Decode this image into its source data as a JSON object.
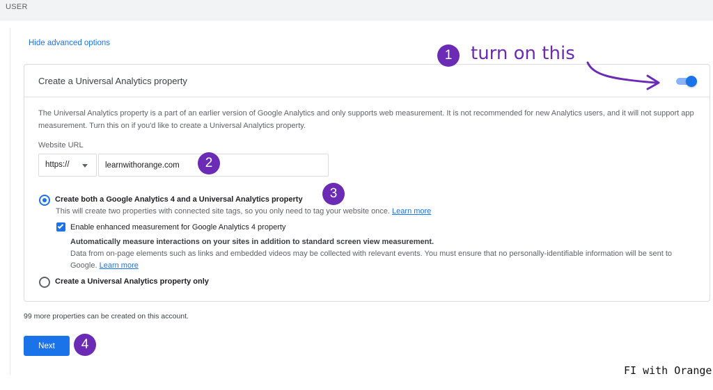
{
  "topbar": {
    "label": "USER"
  },
  "advanced": {
    "hide_label": "Hide advanced options"
  },
  "ua_card": {
    "title": "Create a Universal Analytics property",
    "toggle_on": true,
    "description": "The Universal Analytics property is a part of an earlier version of Google Analytics and only supports web measurement. It is not recommended for new Analytics users, and it will not support app measurement. Turn this on if you'd like to create a Universal Analytics property.",
    "website_url_label": "Website URL",
    "protocol": "https://",
    "url_value": "learnwithorange.com",
    "option_both": {
      "title": "Create both a Google Analytics 4 and a Universal Analytics property",
      "desc": "This will create two properties with connected site tags, so you only need to tag your website once.",
      "learn_more": "Learn more",
      "selected": true
    },
    "enhanced": {
      "label": "Enable enhanced measurement for Google Analytics 4 property",
      "checked": true,
      "title": "Automatically measure interactions on your sites in addition to standard screen view measurement.",
      "desc": "Data from on-page elements such as links and embedded videos may be collected with relevant events. You must ensure that no personally-identifiable information will be sent to Google.",
      "learn_more": "Learn more"
    },
    "option_ua_only": {
      "title": "Create a Universal Analytics property only",
      "selected": false
    }
  },
  "footer": {
    "more_properties": "99 more properties can be created on this account.",
    "next_label": "Next"
  },
  "annotations": {
    "step1": "1",
    "step1_text": "turn on this",
    "step2": "2",
    "step3": "3",
    "step4": "4",
    "color": "#6c2bb5"
  },
  "watermark": "FI with Orange",
  "colors": {
    "accent": "#1a73e8",
    "annotation": "#6c2bb5"
  }
}
